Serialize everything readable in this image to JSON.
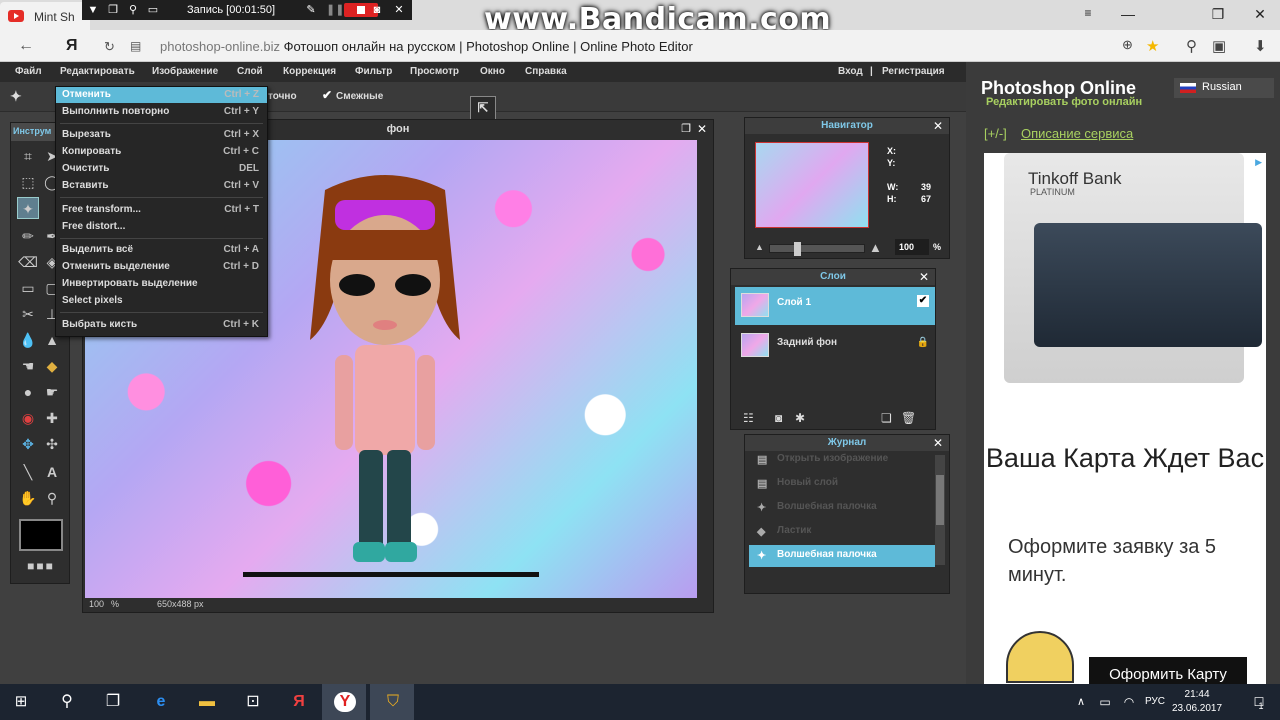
{
  "browser": {
    "tab_title": "Mint Sh",
    "url_domain": "photoshop-online.biz",
    "url_title": "Фотошоп онлайн на русском | Photoshop Online | Online Photo Editor"
  },
  "recorder": {
    "label": "Запись [00:01:50]",
    "watermark": "www.Bandicam.com"
  },
  "menu": {
    "items": [
      "Файл",
      "Редактировать",
      "Изображение",
      "Слой",
      "Коррекция",
      "Фильтр",
      "Просмотр",
      "Окно",
      "Справка"
    ],
    "login": "Вход",
    "separator": "|",
    "register": "Регистрация"
  },
  "options": {
    "points_label": "точно",
    "contiguous_label": "Смежные"
  },
  "toolbox": {
    "title": "Инструм"
  },
  "edit_menu": {
    "items": [
      {
        "label": "Отменить",
        "shortcut": "Ctrl + Z",
        "highlighted": true
      },
      {
        "label": "Выполнить повторно",
        "shortcut": "Ctrl + Y"
      },
      {
        "label": "Вырезать",
        "shortcut": "Ctrl + X"
      },
      {
        "label": "Копировать",
        "shortcut": "Ctrl + C"
      },
      {
        "label": "Очистить",
        "shortcut": "DEL"
      },
      {
        "label": "Вставить",
        "shortcut": "Ctrl + V"
      },
      {
        "label": "Free transform...",
        "shortcut": "Ctrl + T"
      },
      {
        "label": "Free distort...",
        "shortcut": ""
      },
      {
        "label": "Выделить всё",
        "shortcut": "Ctrl + A"
      },
      {
        "label": "Отменить выделение",
        "shortcut": "Ctrl + D"
      },
      {
        "label": "Инвертировать выделение",
        "shortcut": ""
      },
      {
        "label": "Select pixels",
        "shortcut": ""
      },
      {
        "label": "Выбрать кисть",
        "shortcut": "Ctrl + K"
      }
    ]
  },
  "canvas": {
    "title": "фон",
    "zoom": "100",
    "zoom_unit": "%",
    "size": "650x488 px"
  },
  "navigator": {
    "title": "Навигатор",
    "x_label": "X:",
    "y_label": "Y:",
    "w_label": "W:",
    "w_value": "39",
    "h_label": "H:",
    "h_value": "67",
    "zoom": "100",
    "zoom_unit": "%"
  },
  "layers": {
    "title": "Слои",
    "items": [
      {
        "name": "Слой 1",
        "selected": true
      },
      {
        "name": "Задний фон",
        "selected": false
      }
    ]
  },
  "history": {
    "title": "Журнал",
    "items": [
      {
        "label": "Открыть изображение",
        "selected": false
      },
      {
        "label": "Новый слой",
        "selected": false
      },
      {
        "label": "Волшебная палочка",
        "selected": false
      },
      {
        "label": "Ластик",
        "selected": false
      },
      {
        "label": "Волшебная палочка",
        "selected": true
      }
    ]
  },
  "sidebar": {
    "site_title": "Photoshop Online",
    "subtitle": "Редактировать фото онлайн",
    "language": "Russian",
    "service_toggle": "[+/-]",
    "service_link": "Описание сервиса"
  },
  "ad": {
    "brand": "Tinkoff Bank",
    "card_tier": "PLATINUM",
    "headline": "Ваша Карта Ждет Вас",
    "body": "Оформите заявку за 5 минут.",
    "button": "Оформить Карту"
  },
  "taskbar": {
    "lang": "РУС",
    "time": "21:44",
    "date": "23.06.2017",
    "notifications": "1"
  },
  "colors": {
    "accent": "#5ebad8",
    "sidebar_subtitle": "#a8d060",
    "link": "#a8d060"
  }
}
